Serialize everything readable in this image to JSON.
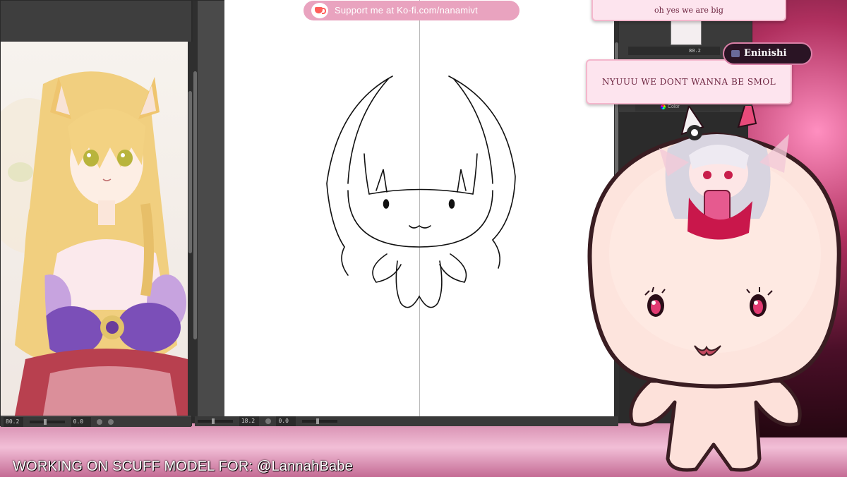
{
  "kofi_banner": {
    "text": "Support me at Ko-fi.com/nanamivt",
    "icon": "ko-fi-cup-icon",
    "color": "#e9a3bf"
  },
  "chat": {
    "top_bubble_text": "oh yes we are big",
    "username": "Eninishi",
    "message": "NYUUU WE DONT WANNA BE SMOL"
  },
  "caption": "WORKING ON SCUFF MODEL FOR: @LannahBabe",
  "left_panel": {
    "statusbar": {
      "zoom": "80.2",
      "rotation": "0.0"
    }
  },
  "canvas_panel": {
    "statusbar": {
      "zoom": "18.2",
      "rotation": "0.0"
    }
  },
  "navigator": {
    "zoom": "80.2",
    "color_tab_label": "Color"
  },
  "colors": {
    "bubble_bg": "#fde4ee",
    "bubble_border": "#f4b6cc",
    "accent_pink": "#d97fa6",
    "app_dark": "#3c3c3c"
  }
}
